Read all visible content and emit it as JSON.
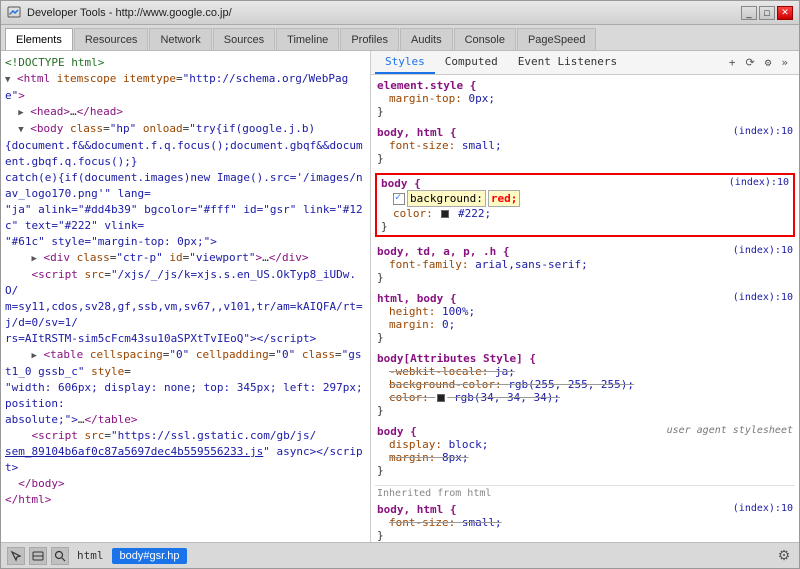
{
  "window": {
    "title": "Developer Tools - http://www.google.co.jp/"
  },
  "toolbar_tabs": [
    {
      "label": "Elements",
      "active": true
    },
    {
      "label": "Resources",
      "active": false
    },
    {
      "label": "Network",
      "active": false
    },
    {
      "label": "Sources",
      "active": false
    },
    {
      "label": "Timeline",
      "active": false
    },
    {
      "label": "Profiles",
      "active": false
    },
    {
      "label": "Audits",
      "active": false
    },
    {
      "label": "Console",
      "active": false
    },
    {
      "label": "PageSpeed",
      "active": false
    }
  ],
  "panel_tabs": [
    {
      "label": "Styles",
      "active": true
    },
    {
      "label": "Computed",
      "active": false
    },
    {
      "label": "Event Listeners",
      "active": false
    }
  ],
  "bottom_toolbar": {
    "selector_tag": "body#gsr.hp",
    "html_label": "html"
  },
  "styles": {
    "rule1": {
      "selector": "element.style {",
      "props": [
        {
          "prop": "margin-top:",
          "val": "0px;",
          "active": true
        }
      ],
      "source": ""
    },
    "rule2": {
      "selector": "body, html {",
      "props": [
        {
          "prop": "font-size:",
          "val": "small;",
          "active": true
        }
      ],
      "source": "(index):10"
    },
    "rule3": {
      "selector": "body {",
      "props": [
        {
          "prop": "background:",
          "val": "red;",
          "active": true,
          "editing": true
        },
        {
          "prop": "color:",
          "val": "#222;",
          "active": true,
          "has_swatch": true
        }
      ],
      "source": "(index):10",
      "editing": true
    },
    "rule4": {
      "selector": "body, td, a, p, .h {",
      "props": [
        {
          "prop": "font-family:",
          "val": "arial,sans-serif;",
          "active": true
        }
      ],
      "source": "(index):10"
    },
    "rule5": {
      "selector": "html, body {",
      "props": [
        {
          "prop": "height:",
          "val": "100%;",
          "active": true
        },
        {
          "prop": "margin:",
          "val": "0;",
          "active": true
        }
      ],
      "source": "(index):10"
    },
    "rule6": {
      "selector": "body[Attributes Style] {",
      "props": [
        {
          "prop": "-webkit-locale:",
          "val": "ja;",
          "active": true,
          "strikethrough": true
        },
        {
          "prop": "background-color:",
          "val": "rgb(255, 255, 255);",
          "active": true,
          "strikethrough": true
        },
        {
          "prop": "color:",
          "val": "rgb(34, 34, 34);",
          "active": true,
          "strikethrough": true,
          "has_swatch": true
        }
      ],
      "source": ""
    },
    "rule7": {
      "selector": "body {",
      "props": [
        {
          "prop": "display:",
          "val": "block;",
          "active": true
        },
        {
          "prop": "margin:",
          "val": "8px;",
          "active": true,
          "strikethrough": true
        }
      ],
      "source": "user agent stylesheet"
    },
    "inherited_label": "Inherited from html",
    "rule8": {
      "selector": "body, html {",
      "props": [
        {
          "prop": "font-size:",
          "val": "small;",
          "active": true,
          "strikethrough": true
        }
      ],
      "source": "(index):10"
    }
  }
}
